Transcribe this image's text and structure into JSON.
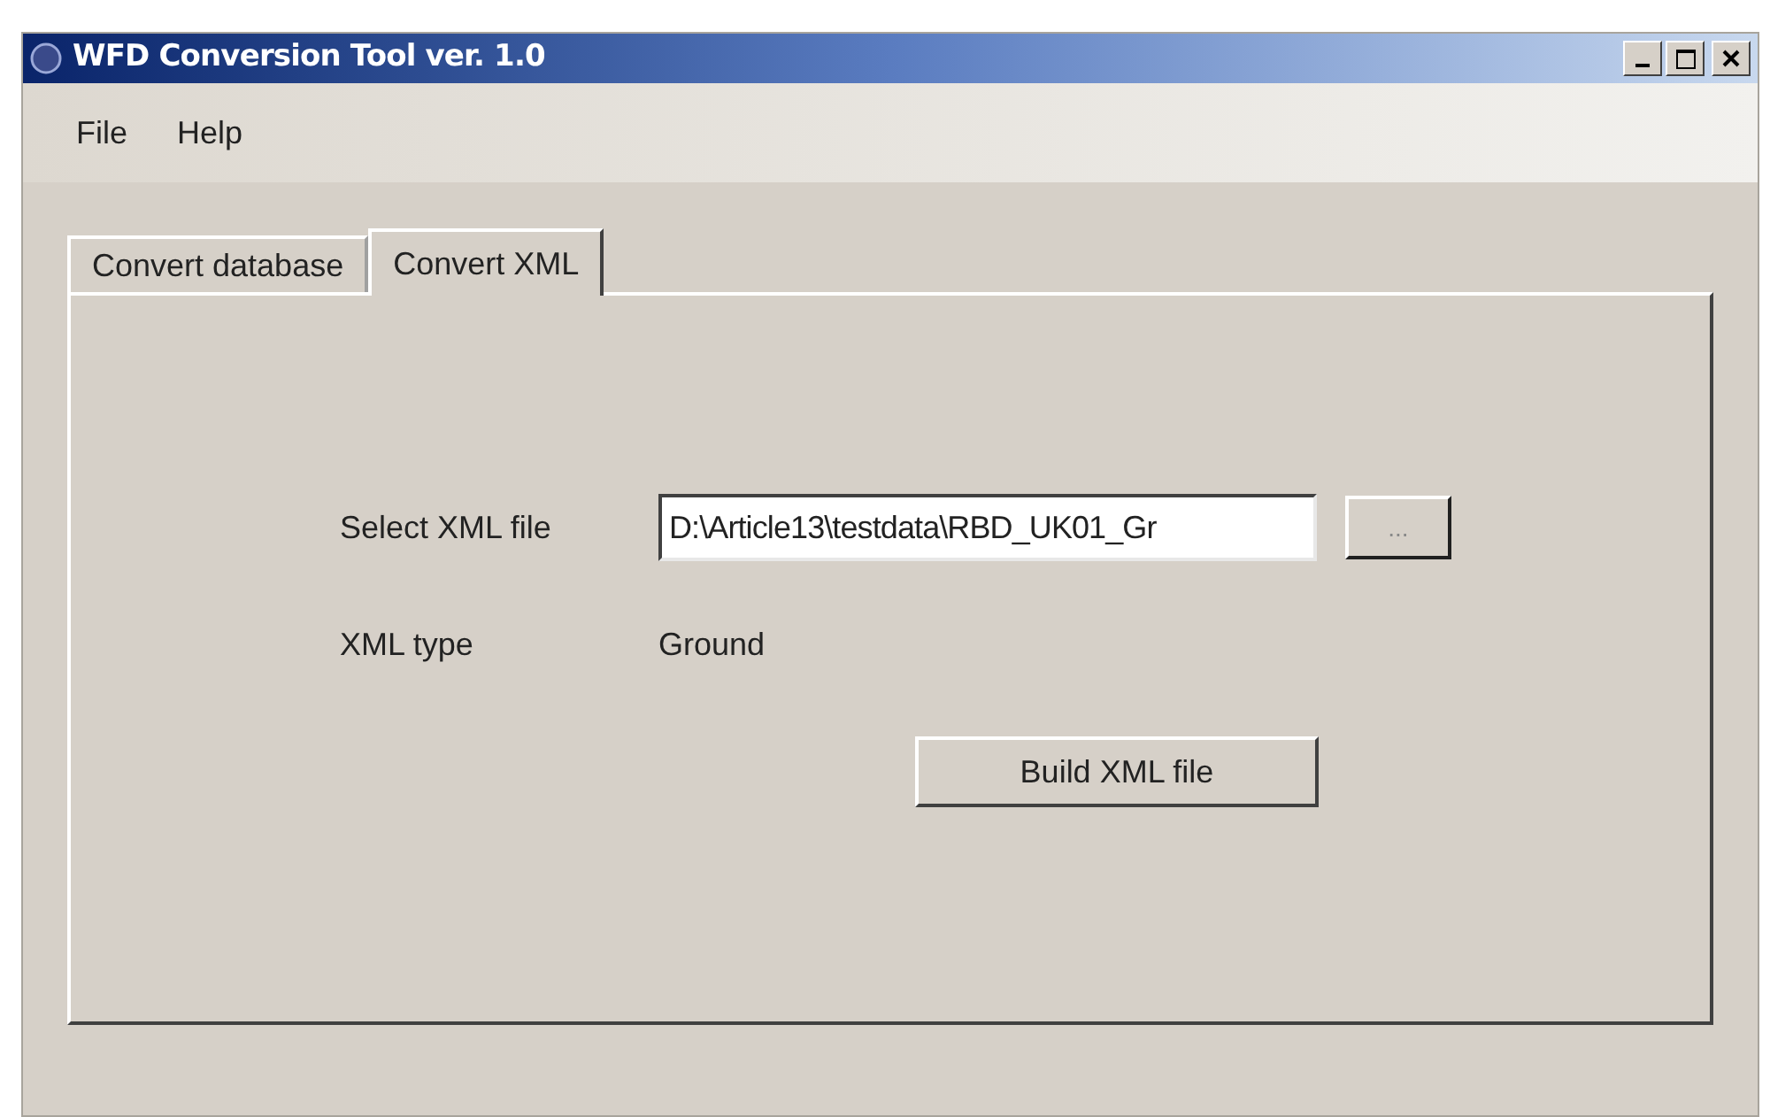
{
  "window": {
    "title": "WFD Conversion Tool ver. 1.0"
  },
  "menu": [
    "File",
    "Help"
  ],
  "tabs": [
    {
      "label": "Convert database",
      "selected": false
    },
    {
      "label": "Convert XML",
      "selected": true
    }
  ],
  "form": {
    "file_label": "Select XML file",
    "file_value": "D:\\Article13\\testdata\\RBD_UK01_Gr",
    "browse_button": "...",
    "type_label": "XML type",
    "type_value": "Ground",
    "build_button": "Build XML file"
  }
}
